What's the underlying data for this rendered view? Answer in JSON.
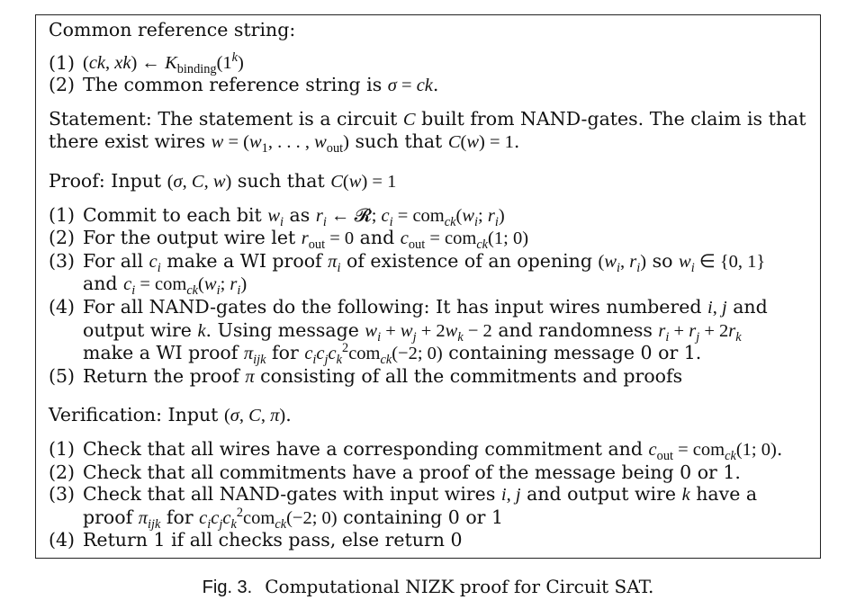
{
  "crs": {
    "heading": "Common reference string:",
    "items": [
      {
        "num": "(1)",
        "text": ""
      },
      {
        "num": "(2)",
        "text": "The common reference string is"
      }
    ]
  },
  "statement": {
    "label": "Statement:",
    "line1": "The statement is a circuit",
    "line1b": "built from NAND-gates. The claim is that",
    "line2": "there exist wires",
    "line2b": "such that"
  },
  "proof": {
    "heading": "Proof: Input",
    "heading_b": "such that",
    "items": [
      {
        "num": "(1)",
        "text": "Commit to each bit",
        "text_b": "as"
      },
      {
        "num": "(2)",
        "text": "For the output wire let",
        "text_b": "and"
      },
      {
        "num": "(3)",
        "text": "For all",
        "text_b": "make a WI proof",
        "text_c": "of existence of an opening",
        "text_d": "so",
        "text_e": "and"
      },
      {
        "num": "(4)",
        "text": "For all NAND-gates do the following: It has input wires numbered",
        "text_b": "and",
        "text_c": "output wire",
        "text_d": ". Using message",
        "text_e": "and randomness",
        "text_f": "make a WI proof",
        "text_g": "for",
        "text_h": "containing message 0 or 1."
      },
      {
        "num": "(5)",
        "text": "Return the proof",
        "text_b": "consisting of all the commitments and proofs"
      }
    ]
  },
  "verification": {
    "heading": "Verification: Input",
    "items": [
      {
        "num": "(1)",
        "text": "Check that all wires have a corresponding commitment and"
      },
      {
        "num": "(2)",
        "text": "Check that all commitments have a proof of the message being 0 or 1."
      },
      {
        "num": "(3)",
        "text": "Check that all NAND-gates with input wires",
        "text_b": "and output wire",
        "text_c": "have a",
        "text_d": "proof",
        "text_e": "for",
        "text_f": "containing 0 or 1"
      },
      {
        "num": "(4)",
        "text": "Return 1 if all checks pass, else return 0"
      }
    ]
  },
  "caption": {
    "label": "Fig. 3.",
    "text": "Computational NIZK proof for Circuit SAT."
  }
}
